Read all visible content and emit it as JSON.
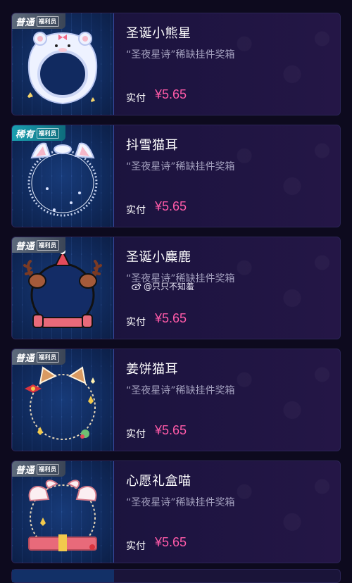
{
  "items": [
    {
      "badge": "普通",
      "badge_sub": "福利员",
      "badge_type": "normal",
      "title": "圣诞小熊星",
      "desc": "“圣夜星诗”稀缺挂件奖箱",
      "price_label": "实付",
      "price": "¥5.65",
      "icon": "polar-bear-hood-frame-icon"
    },
    {
      "badge": "稀有",
      "badge_sub": "福利员",
      "badge_type": "rare",
      "title": "抖雪猫耳",
      "desc": "“圣夜星诗”稀缺挂件奖箱",
      "price_label": "实付",
      "price": "¥5.65",
      "icon": "snow-cat-ear-frame-icon"
    },
    {
      "badge": "普通",
      "badge_sub": "福利员",
      "badge_type": "normal",
      "title": "圣诞小麋鹿",
      "desc": "“圣夜星诗”稀缺挂件奖箱",
      "price_label": "实付",
      "price": "¥5.65",
      "icon": "christmas-reindeer-frame-icon"
    },
    {
      "badge": "普通",
      "badge_sub": "福利员",
      "badge_type": "normal",
      "title": "姜饼猫耳",
      "desc": "“圣夜星诗”稀缺挂件奖箱",
      "price_label": "实付",
      "price": "¥5.65",
      "icon": "gingerbread-cat-ear-frame-icon"
    },
    {
      "badge": "普通",
      "badge_sub": "福利员",
      "badge_type": "normal",
      "title": "心愿礼盒喵",
      "desc": "“圣夜星诗”稀缺挂件奖箱",
      "price_label": "实付",
      "price": "¥5.65",
      "icon": "gift-box-cat-frame-icon"
    }
  ],
  "watermark": {
    "text": "@只只不知羞",
    "icon": "weibo-icon"
  },
  "colors": {
    "price": "#ff5aa8",
    "card_bg": "#1d1440",
    "page_bg": "#0d0a1e"
  }
}
